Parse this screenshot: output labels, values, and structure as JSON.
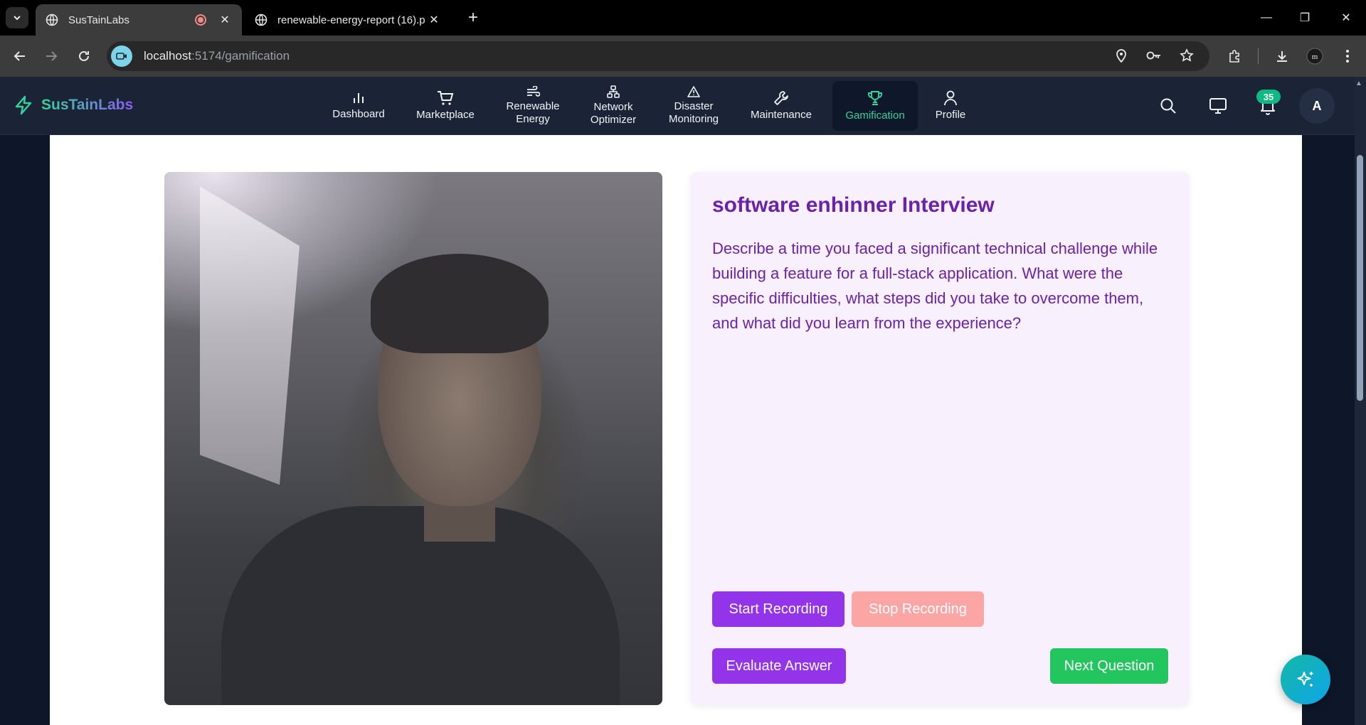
{
  "browser": {
    "tabs": [
      {
        "title": "SusTainLabs",
        "active": true
      },
      {
        "title": "renewable-energy-report (16).p",
        "active": false
      }
    ],
    "url_host": "localhost",
    "url_path": ":5174/gamification"
  },
  "app": {
    "brand": "SusTainLabs",
    "nav": [
      {
        "label": "Dashboard",
        "icon": "bar-chart-icon"
      },
      {
        "label": "Marketplace",
        "icon": "cart-icon"
      },
      {
        "label": "Renewable\nEnergy",
        "icon": "wind-icon"
      },
      {
        "label": "Network\nOptimizer",
        "icon": "network-icon"
      },
      {
        "label": "Disaster\nMonitoring",
        "icon": "warning-icon"
      },
      {
        "label": "Maintenance",
        "icon": "wrench-icon"
      },
      {
        "label": "Gamification",
        "icon": "trophy-icon",
        "active": true
      },
      {
        "label": "Profile",
        "icon": "user-icon"
      }
    ],
    "notification_count": "35",
    "avatar_initial": "A",
    "accent_color": "#34d399"
  },
  "interview": {
    "title": "software enhinner Interview",
    "question": "Describe a time you faced a significant technical challenge while building a feature for a full-stack application. What were the specific difficulties, what steps did you take to overcome them, and what did you learn from the experience?",
    "start_label": "Start Recording",
    "stop_label": "Stop Recording",
    "evaluate_label": "Evaluate Answer",
    "next_label": "Next Question"
  }
}
